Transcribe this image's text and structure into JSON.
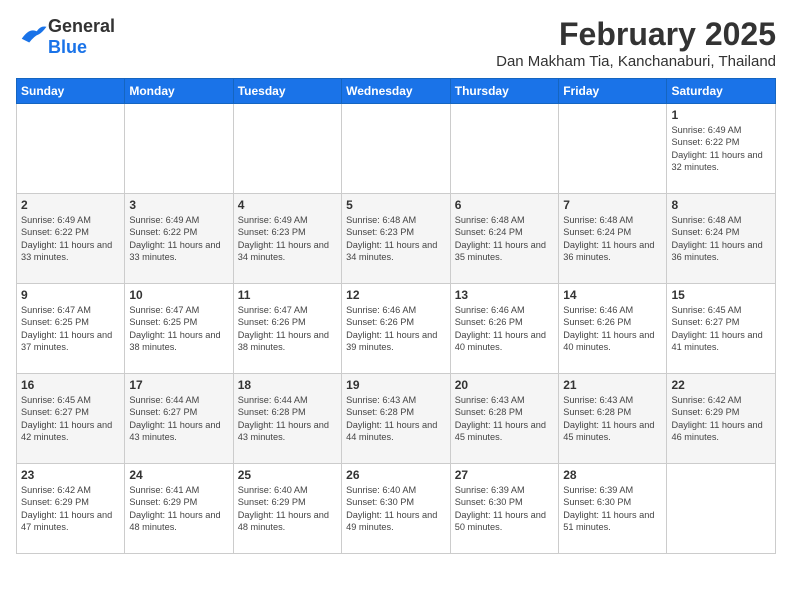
{
  "header": {
    "logo_text_general": "General",
    "logo_text_blue": "Blue",
    "month_title": "February 2025",
    "location": "Dan Makham Tia, Kanchanaburi, Thailand"
  },
  "days_of_week": [
    "Sunday",
    "Monday",
    "Tuesday",
    "Wednesday",
    "Thursday",
    "Friday",
    "Saturday"
  ],
  "weeks": [
    [
      {
        "day": "",
        "info": ""
      },
      {
        "day": "",
        "info": ""
      },
      {
        "day": "",
        "info": ""
      },
      {
        "day": "",
        "info": ""
      },
      {
        "day": "",
        "info": ""
      },
      {
        "day": "",
        "info": ""
      },
      {
        "day": "1",
        "info": "Sunrise: 6:49 AM\nSunset: 6:22 PM\nDaylight: 11 hours and 32 minutes."
      }
    ],
    [
      {
        "day": "2",
        "info": "Sunrise: 6:49 AM\nSunset: 6:22 PM\nDaylight: 11 hours and 33 minutes."
      },
      {
        "day": "3",
        "info": "Sunrise: 6:49 AM\nSunset: 6:22 PM\nDaylight: 11 hours and 33 minutes."
      },
      {
        "day": "4",
        "info": "Sunrise: 6:49 AM\nSunset: 6:23 PM\nDaylight: 11 hours and 34 minutes."
      },
      {
        "day": "5",
        "info": "Sunrise: 6:48 AM\nSunset: 6:23 PM\nDaylight: 11 hours and 34 minutes."
      },
      {
        "day": "6",
        "info": "Sunrise: 6:48 AM\nSunset: 6:24 PM\nDaylight: 11 hours and 35 minutes."
      },
      {
        "day": "7",
        "info": "Sunrise: 6:48 AM\nSunset: 6:24 PM\nDaylight: 11 hours and 36 minutes."
      },
      {
        "day": "8",
        "info": "Sunrise: 6:48 AM\nSunset: 6:24 PM\nDaylight: 11 hours and 36 minutes."
      }
    ],
    [
      {
        "day": "9",
        "info": "Sunrise: 6:47 AM\nSunset: 6:25 PM\nDaylight: 11 hours and 37 minutes."
      },
      {
        "day": "10",
        "info": "Sunrise: 6:47 AM\nSunset: 6:25 PM\nDaylight: 11 hours and 38 minutes."
      },
      {
        "day": "11",
        "info": "Sunrise: 6:47 AM\nSunset: 6:26 PM\nDaylight: 11 hours and 38 minutes."
      },
      {
        "day": "12",
        "info": "Sunrise: 6:46 AM\nSunset: 6:26 PM\nDaylight: 11 hours and 39 minutes."
      },
      {
        "day": "13",
        "info": "Sunrise: 6:46 AM\nSunset: 6:26 PM\nDaylight: 11 hours and 40 minutes."
      },
      {
        "day": "14",
        "info": "Sunrise: 6:46 AM\nSunset: 6:26 PM\nDaylight: 11 hours and 40 minutes."
      },
      {
        "day": "15",
        "info": "Sunrise: 6:45 AM\nSunset: 6:27 PM\nDaylight: 11 hours and 41 minutes."
      }
    ],
    [
      {
        "day": "16",
        "info": "Sunrise: 6:45 AM\nSunset: 6:27 PM\nDaylight: 11 hours and 42 minutes."
      },
      {
        "day": "17",
        "info": "Sunrise: 6:44 AM\nSunset: 6:27 PM\nDaylight: 11 hours and 43 minutes."
      },
      {
        "day": "18",
        "info": "Sunrise: 6:44 AM\nSunset: 6:28 PM\nDaylight: 11 hours and 43 minutes."
      },
      {
        "day": "19",
        "info": "Sunrise: 6:43 AM\nSunset: 6:28 PM\nDaylight: 11 hours and 44 minutes."
      },
      {
        "day": "20",
        "info": "Sunrise: 6:43 AM\nSunset: 6:28 PM\nDaylight: 11 hours and 45 minutes."
      },
      {
        "day": "21",
        "info": "Sunrise: 6:43 AM\nSunset: 6:28 PM\nDaylight: 11 hours and 45 minutes."
      },
      {
        "day": "22",
        "info": "Sunrise: 6:42 AM\nSunset: 6:29 PM\nDaylight: 11 hours and 46 minutes."
      }
    ],
    [
      {
        "day": "23",
        "info": "Sunrise: 6:42 AM\nSunset: 6:29 PM\nDaylight: 11 hours and 47 minutes."
      },
      {
        "day": "24",
        "info": "Sunrise: 6:41 AM\nSunset: 6:29 PM\nDaylight: 11 hours and 48 minutes."
      },
      {
        "day": "25",
        "info": "Sunrise: 6:40 AM\nSunset: 6:29 PM\nDaylight: 11 hours and 48 minutes."
      },
      {
        "day": "26",
        "info": "Sunrise: 6:40 AM\nSunset: 6:30 PM\nDaylight: 11 hours and 49 minutes."
      },
      {
        "day": "27",
        "info": "Sunrise: 6:39 AM\nSunset: 6:30 PM\nDaylight: 11 hours and 50 minutes."
      },
      {
        "day": "28",
        "info": "Sunrise: 6:39 AM\nSunset: 6:30 PM\nDaylight: 11 hours and 51 minutes."
      },
      {
        "day": "",
        "info": ""
      }
    ]
  ]
}
